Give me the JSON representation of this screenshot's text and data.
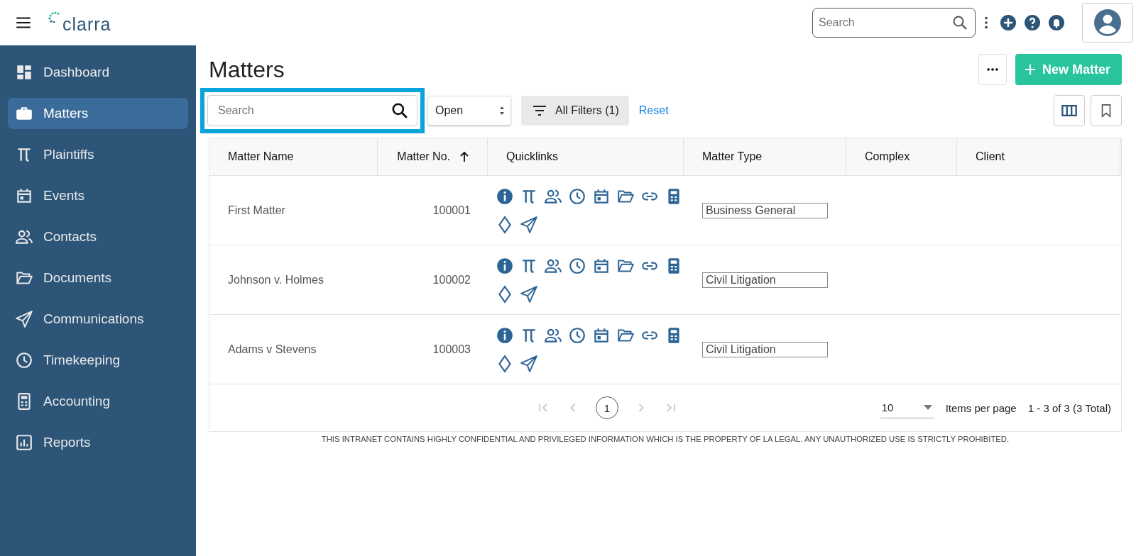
{
  "header": {
    "logo": "clarra",
    "search": {
      "placeholder": "Search"
    }
  },
  "sidebar": {
    "items": [
      {
        "label": "Dashboard",
        "selected": false
      },
      {
        "label": "Matters",
        "selected": true
      },
      {
        "label": "Plaintiffs",
        "selected": false
      },
      {
        "label": "Events",
        "selected": false
      },
      {
        "label": "Contacts",
        "selected": false
      },
      {
        "label": "Documents",
        "selected": false
      },
      {
        "label": "Communications",
        "selected": false
      },
      {
        "label": "Timekeeping",
        "selected": false
      },
      {
        "label": "Accounting",
        "selected": false
      },
      {
        "label": "Reports",
        "selected": false
      }
    ]
  },
  "page": {
    "title": "Matters",
    "new_button": "New Matter"
  },
  "filters": {
    "search": {
      "placeholder": "Search"
    },
    "status": "Open",
    "all_filters": "All Filters (1)",
    "reset": "Reset"
  },
  "table": {
    "columns": [
      {
        "label": "Matter Name",
        "sorted": false
      },
      {
        "label": "Matter No.",
        "sorted": true
      },
      {
        "label": "Quicklinks",
        "sorted": false
      },
      {
        "label": "Matter Type",
        "sorted": false
      },
      {
        "label": "Complex",
        "sorted": false
      },
      {
        "label": "Client",
        "sorted": false
      }
    ],
    "rows": [
      {
        "name": "First Matter",
        "number": "100001",
        "type": "Business General"
      },
      {
        "name": "Johnson v. Holmes",
        "number": "100002",
        "type": "Civil Litigation"
      },
      {
        "name": "Adams v Stevens",
        "number": "100003",
        "type": "Civil Litigation"
      }
    ]
  },
  "pagination": {
    "current_page": "1",
    "page_size": "10",
    "page_size_label": "Items per page",
    "range": "1 - 3 of 3 (3 Total)"
  },
  "footer": "THIS INTRANET CONTAINS HIGHLY CONFIDENTIAL AND PRIVILEGED INFORMATION WHICH IS THE PROPERTY OF LA LEGAL. ANY UNAUTHORIZED USE IS STRICTLY PROHIBITED."
}
